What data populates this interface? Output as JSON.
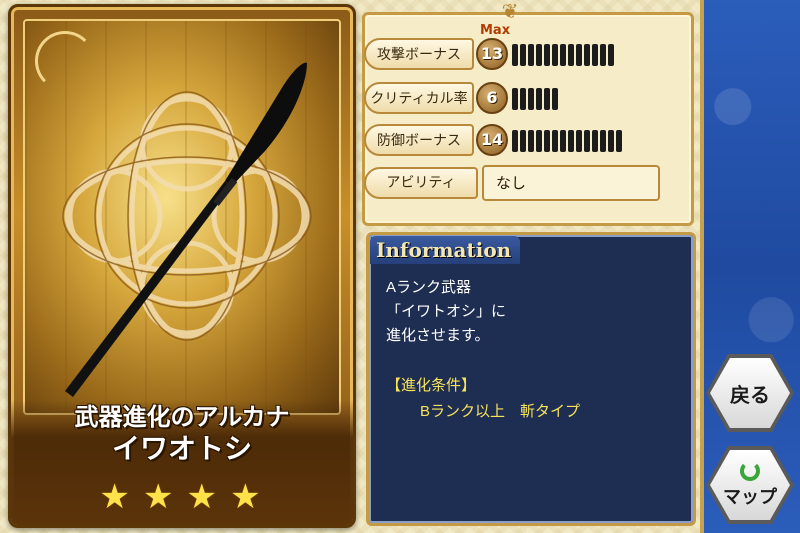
{
  "card": {
    "subtitle": "武器進化のアルカナ",
    "name": "イワオトシ",
    "stars": [
      "★",
      "★",
      "★",
      "★"
    ]
  },
  "stats": {
    "max_label": "Max",
    "rows": [
      {
        "label": "攻撃ボーナス",
        "value": "13",
        "bars": 13
      },
      {
        "label": "クリティカル率",
        "value": "6",
        "bars": 6
      },
      {
        "label": "防御ボーナス",
        "value": "14",
        "bars": 14
      }
    ],
    "ability_label": "アビリティ",
    "ability_value": "なし"
  },
  "info": {
    "title": "Information",
    "line1": "Aランク武器",
    "line2": "「イワトオシ」に",
    "line3": "進化させます。",
    "cond_title": "【進化条件】",
    "cond_text": "Bランク以上　斬タイプ"
  },
  "buttons": {
    "back_label": "戻る",
    "map_label": "マップ"
  },
  "colors": {
    "info_bg": "#1e2d52",
    "accent_gold": "#c59a45",
    "condition_yellow": "#f6e35a",
    "side_blue": "#2b5dbb"
  }
}
